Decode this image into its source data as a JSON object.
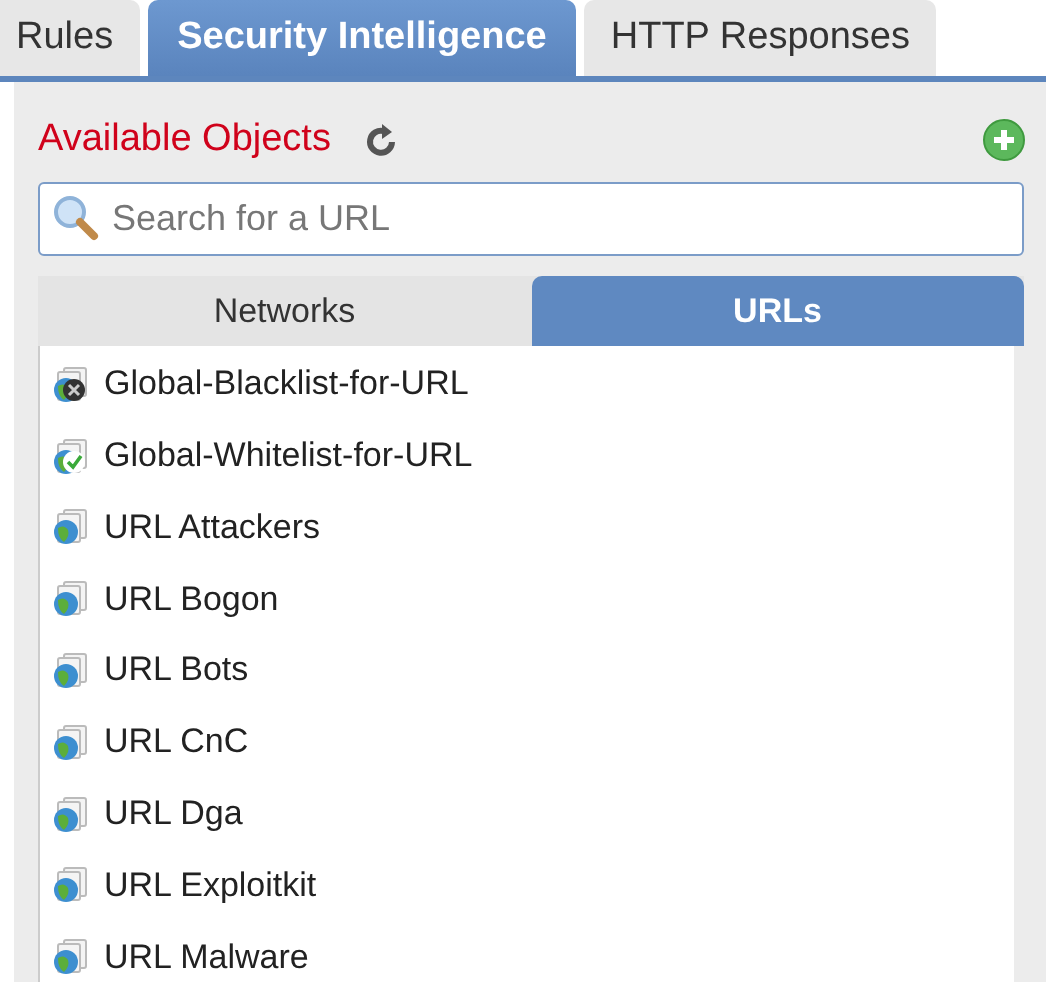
{
  "tabs": [
    {
      "label": "Rules",
      "selected": false
    },
    {
      "label": "Security Intelligence",
      "selected": true
    },
    {
      "label": "HTTP Responses",
      "selected": false
    }
  ],
  "panel": {
    "title": "Available Objects",
    "search": {
      "placeholder": "Search for a URL"
    },
    "subtabs": [
      {
        "label": "Networks",
        "selected": false
      },
      {
        "label": "URLs",
        "selected": true
      }
    ],
    "items": [
      {
        "label": "Global-Blacklist-for-URL",
        "kind": "blacklist"
      },
      {
        "label": "Global-Whitelist-for-URL",
        "kind": "whitelist"
      },
      {
        "label": "URL Attackers",
        "kind": "url"
      },
      {
        "label": "URL Bogon",
        "kind": "url"
      },
      {
        "label": "URL Bots",
        "kind": "url"
      },
      {
        "label": "URL CnC",
        "kind": "url"
      },
      {
        "label": "URL Dga",
        "kind": "url"
      },
      {
        "label": "URL Exploitkit",
        "kind": "url"
      },
      {
        "label": "URL Malware",
        "kind": "url"
      }
    ]
  }
}
